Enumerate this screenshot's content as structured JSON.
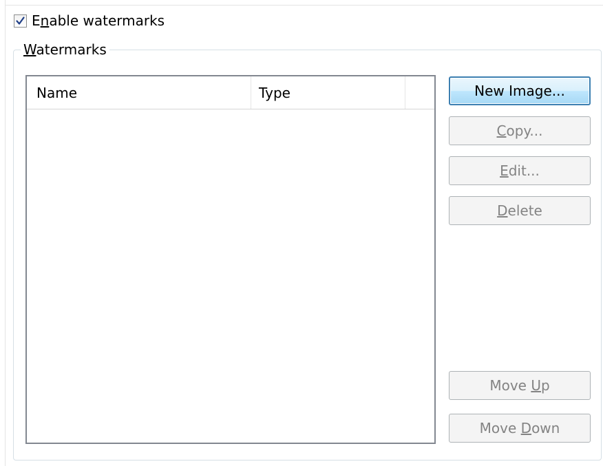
{
  "enable": {
    "label_before": "E",
    "label_mnemonic": "n",
    "label_after": "able watermarks",
    "checked": true
  },
  "group": {
    "legend_mnemonic": "W",
    "legend_after": "atermarks"
  },
  "list": {
    "columns": [
      "Name",
      "Type",
      ""
    ],
    "rows": []
  },
  "buttons": {
    "new_image": "New Image...",
    "copy": {
      "mnemonic": "C",
      "after": "opy..."
    },
    "edit": {
      "mnemonic": "E",
      "after": "dit..."
    },
    "delete": {
      "mnemonic": "D",
      "after": "elete"
    },
    "move_up": {
      "before": "Move ",
      "mnemonic": "U",
      "after": "p"
    },
    "move_down": {
      "before": "Move ",
      "mnemonic": "D",
      "after": "own"
    }
  },
  "icons": {
    "checkbox_check": "check-icon"
  },
  "colors": {
    "primary_border": "#3c7fb1",
    "disabled_text": "#838383",
    "check_mark": "#1f3f87"
  }
}
